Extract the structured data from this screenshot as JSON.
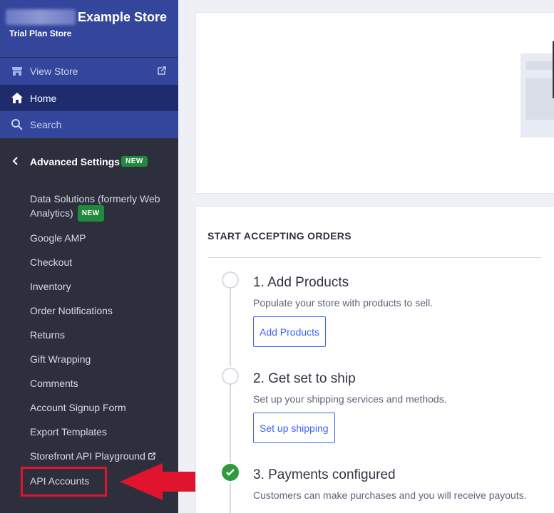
{
  "store": {
    "name": "Example Store",
    "plan": "Trial Plan Store"
  },
  "nav": {
    "view_store": "View Store",
    "home": "Home",
    "search": "Search"
  },
  "advanced": {
    "title": "Advanced Settings",
    "badge": "NEW",
    "items": [
      {
        "label": "Data Solutions (formerly Web Analytics)",
        "badge": "NEW"
      },
      {
        "label": "Google AMP"
      },
      {
        "label": "Checkout"
      },
      {
        "label": "Inventory"
      },
      {
        "label": "Order Notifications"
      },
      {
        "label": "Returns"
      },
      {
        "label": "Gift Wrapping"
      },
      {
        "label": "Comments"
      },
      {
        "label": "Account Signup Form"
      },
      {
        "label": "Export Templates"
      },
      {
        "label": "Storefront API Playground",
        "external": true
      },
      {
        "label": "API Accounts"
      }
    ]
  },
  "orders": {
    "title": "START ACCEPTING ORDERS",
    "steps": [
      {
        "title": "1. Add Products",
        "desc": "Populate your store with products to sell.",
        "button": "Add Products",
        "done": false
      },
      {
        "title": "2. Get set to ship",
        "desc": "Set up your shipping services and methods.",
        "button": "Set up shipping",
        "done": false
      },
      {
        "title": "3. Payments configured",
        "desc": "Customers can make purchases and you will receive payouts.",
        "done": true
      }
    ]
  },
  "colors": {
    "sidebar": "#2e2f3d",
    "header": "#34469b",
    "active": "#1e2c6e",
    "accent": "#3c64f4",
    "badge": "#218a3c",
    "highlight": "#e0142c"
  },
  "icons": {
    "view_store": "storefront-icon",
    "home": "home-icon",
    "search": "search-icon",
    "external": "external-link-icon",
    "back": "chevron-left-icon",
    "done": "checkmark-icon"
  }
}
